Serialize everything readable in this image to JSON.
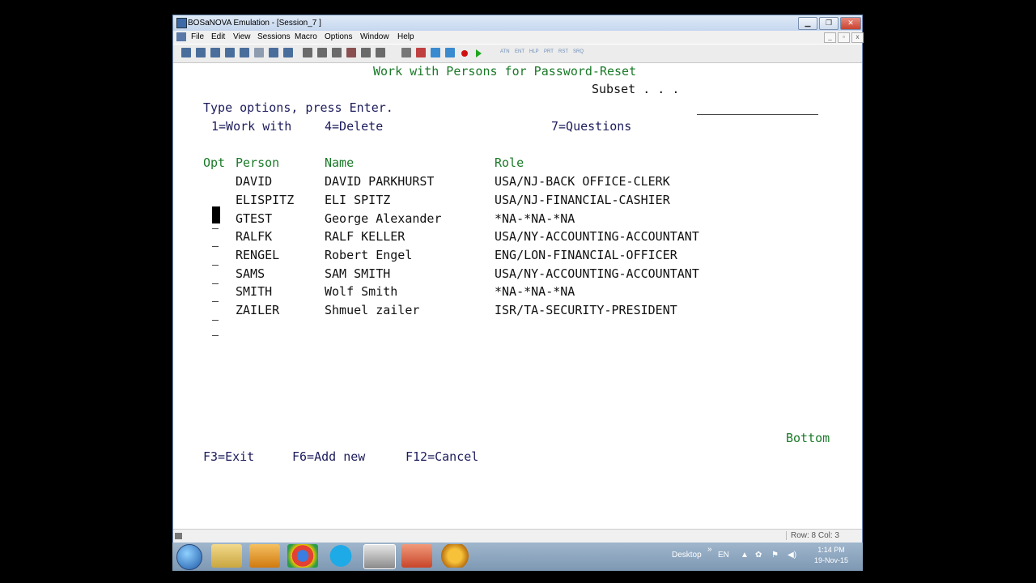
{
  "window": {
    "title": "BOSaNOVA Emulation - [Session_7 ]"
  },
  "menu": [
    "File",
    "Edit",
    "View",
    "Sessions",
    "Macro",
    "Options",
    "Window",
    "Help"
  ],
  "toolbar_text_buttons": [
    "ATN",
    "ENT",
    "HLP",
    "PRT",
    "RST",
    "SRQ"
  ],
  "screen": {
    "title": "Work with Persons for Password-Reset",
    "subset_label": "Subset . . .",
    "instruction": "Type options, press Enter.",
    "options": [
      "1=Work with",
      "4=Delete",
      "7=Questions"
    ],
    "headers": {
      "opt": "Opt",
      "person": "Person",
      "name": "Name",
      "role": "Role"
    },
    "rows": [
      {
        "person": "DAVID",
        "name": "DAVID PARKHURST",
        "role": "USA/NJ-BACK OFFICE-CLERK"
      },
      {
        "person": "ELISPITZ",
        "name": "ELI SPITZ",
        "role": "USA/NJ-FINANCIAL-CASHIER"
      },
      {
        "person": "GTEST",
        "name": "George Alexander",
        "role": "*NA-*NA-*NA"
      },
      {
        "person": "RALFK",
        "name": "RALF KELLER",
        "role": "USA/NY-ACCOUNTING-ACCOUNTANT"
      },
      {
        "person": "RENGEL",
        "name": "Robert Engel",
        "role": "ENG/LON-FINANCIAL-OFFICER"
      },
      {
        "person": "SAMS",
        "name": "SAM SMITH",
        "role": "USA/NY-ACCOUNTING-ACCOUNTANT"
      },
      {
        "person": "SMITH",
        "name": "Wolf Smith",
        "role": "*NA-*NA-*NA"
      },
      {
        "person": "ZAILER",
        "name": "Shmuel zailer",
        "role": "ISR/TA-SECURITY-PRESIDENT"
      }
    ],
    "bottom": "Bottom",
    "fkeys": [
      "F3=Exit",
      "F6=Add new",
      "F12=Cancel"
    ]
  },
  "status": {
    "rowcol": "Row: 8  Col: 3"
  },
  "taskbar": {
    "desktop": "Desktop",
    "lang": "EN",
    "time": "1:14 PM",
    "date": "19-Nov-15"
  },
  "colors": {
    "screen_green": "#1a7a28",
    "screen_blue": "#1c1c5c"
  }
}
